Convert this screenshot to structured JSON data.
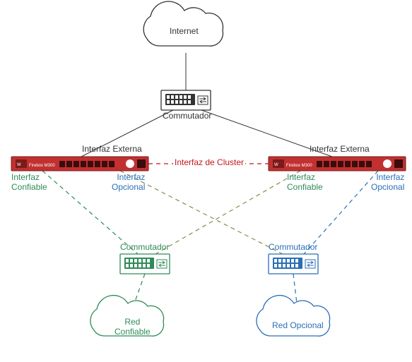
{
  "colors": {
    "black": "#333333",
    "red": "#c01818",
    "green": "#2e8b57",
    "blue": "#2a6fb5",
    "olive": "#8a8a4a",
    "deviceRed": "#c23030",
    "deviceRedDark": "#7a1a1a"
  },
  "labels": {
    "internet": "Internet",
    "commSwitchTop": "Commutador",
    "extIfLeft": "Interfaz Externa",
    "extIfRight": "Interfaz Externa",
    "clusterIf": "Interfaz de Cluster",
    "trustedIfLeft": "Interfaz\nConfiable",
    "optionalIfLeft": "Interfaz\nOpcional",
    "trustedIfRight": "Interfaz\nConfiable",
    "optionalIfRight": "Interfaz\nOpcional",
    "commSwitchGreen": "Commutador",
    "commSwitchBlue": "Commutador",
    "trustedNet": "Red\nConfiable",
    "optionalNet": "Red Opcional"
  }
}
